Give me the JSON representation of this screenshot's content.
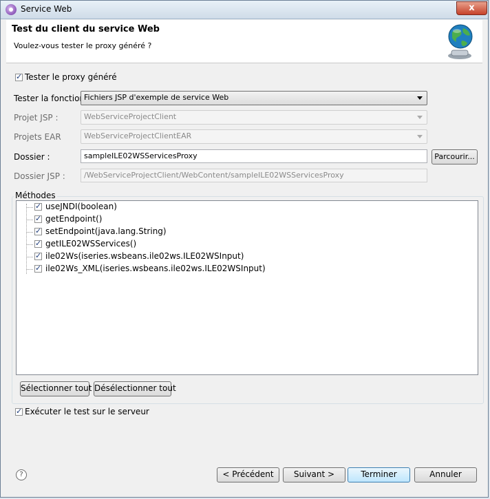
{
  "window": {
    "title": "Service Web",
    "close_glyph": "x"
  },
  "header": {
    "title": "Test du client du service Web",
    "subtitle": "Voulez-vous tester le proxy généré ?",
    "icon": "globe-wizard-icon"
  },
  "test_proxy": {
    "label": "Tester le proxy généré",
    "checked": true
  },
  "form": {
    "fonction": {
      "label": "Tester la fonction",
      "value": "Fichiers JSP d'exemple de service Web"
    },
    "projet_jsp": {
      "label": "Projet JSP :",
      "value": "WebServiceProjectClient"
    },
    "projets_ear": {
      "label": "Projets EAR",
      "value": "WebServiceProjectClientEAR"
    },
    "dossier": {
      "label": "Dossier :",
      "value": "sampleILE02WSServicesProxy",
      "browse_label": "Parcourir..."
    },
    "dossier_jsp": {
      "label": "Dossier JSP :",
      "value": "/WebServiceProjectClient/WebContent/sampleILE02WSServicesProxy"
    }
  },
  "methods": {
    "group_label": "Méthodes",
    "items": [
      {
        "label": "useJNDI(boolean)",
        "checked": true
      },
      {
        "label": "getEndpoint()",
        "checked": true
      },
      {
        "label": "setEndpoint(java.lang.String)",
        "checked": true
      },
      {
        "label": "getILE02WSServices()",
        "checked": true
      },
      {
        "label": "ile02Ws(iseries.wsbeans.ile02ws.ILE02WSInput)",
        "checked": true
      },
      {
        "label": "ile02Ws_XML(iseries.wsbeans.ile02ws.ILE02WSInput)",
        "checked": true
      }
    ],
    "select_all": "Sélectionner tout",
    "deselect_all": "Désélectionner tout"
  },
  "run_on_server": {
    "label": "Exécuter le test sur le serveur",
    "checked": true
  },
  "footer": {
    "help_glyph": "?",
    "previous": "< Précédent",
    "next": "Suivant >",
    "finish": "Terminer",
    "cancel": "Annuler"
  }
}
